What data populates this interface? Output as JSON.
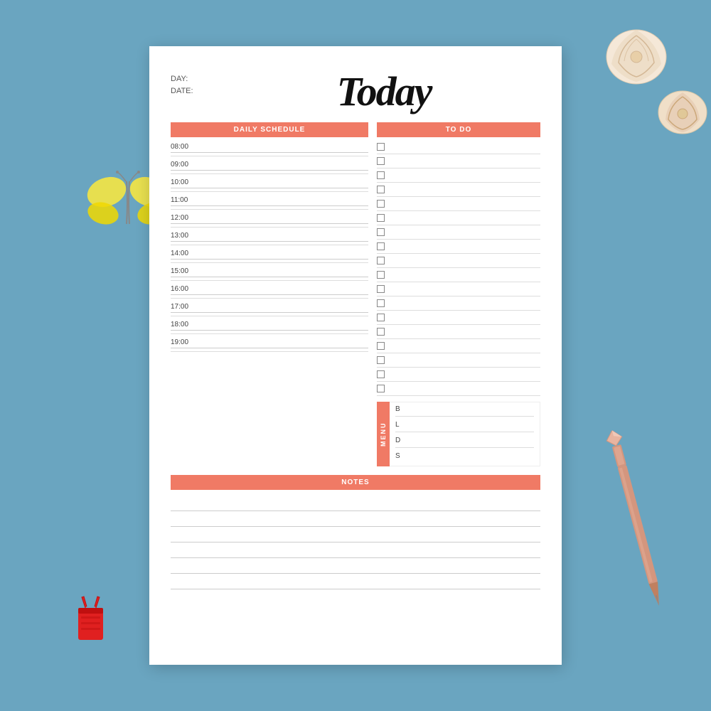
{
  "background": {
    "color": "#6aa5c0"
  },
  "paper": {
    "title": "Today",
    "day_label": "DAY:",
    "date_label": "DATE:",
    "schedule": {
      "header": "DAILY SCHEDULE",
      "times": [
        "08:00",
        "09:00",
        "10:00",
        "11:00",
        "12:00",
        "13:00",
        "14:00",
        "15:00",
        "16:00",
        "17:00",
        "18:00",
        "19:00"
      ]
    },
    "todo": {
      "header": "TO DO",
      "items": 18
    },
    "menu": {
      "label": "MENU",
      "items": [
        {
          "letter": "B",
          "value": ""
        },
        {
          "letter": "L",
          "value": ""
        },
        {
          "letter": "D",
          "value": ""
        },
        {
          "letter": "S",
          "value": ""
        }
      ]
    },
    "notes": {
      "header": "NOTES",
      "lines": 6
    }
  },
  "colors": {
    "accent": "#f07a65",
    "text_dark": "#111",
    "text_mid": "#444",
    "line": "#cccccc"
  }
}
